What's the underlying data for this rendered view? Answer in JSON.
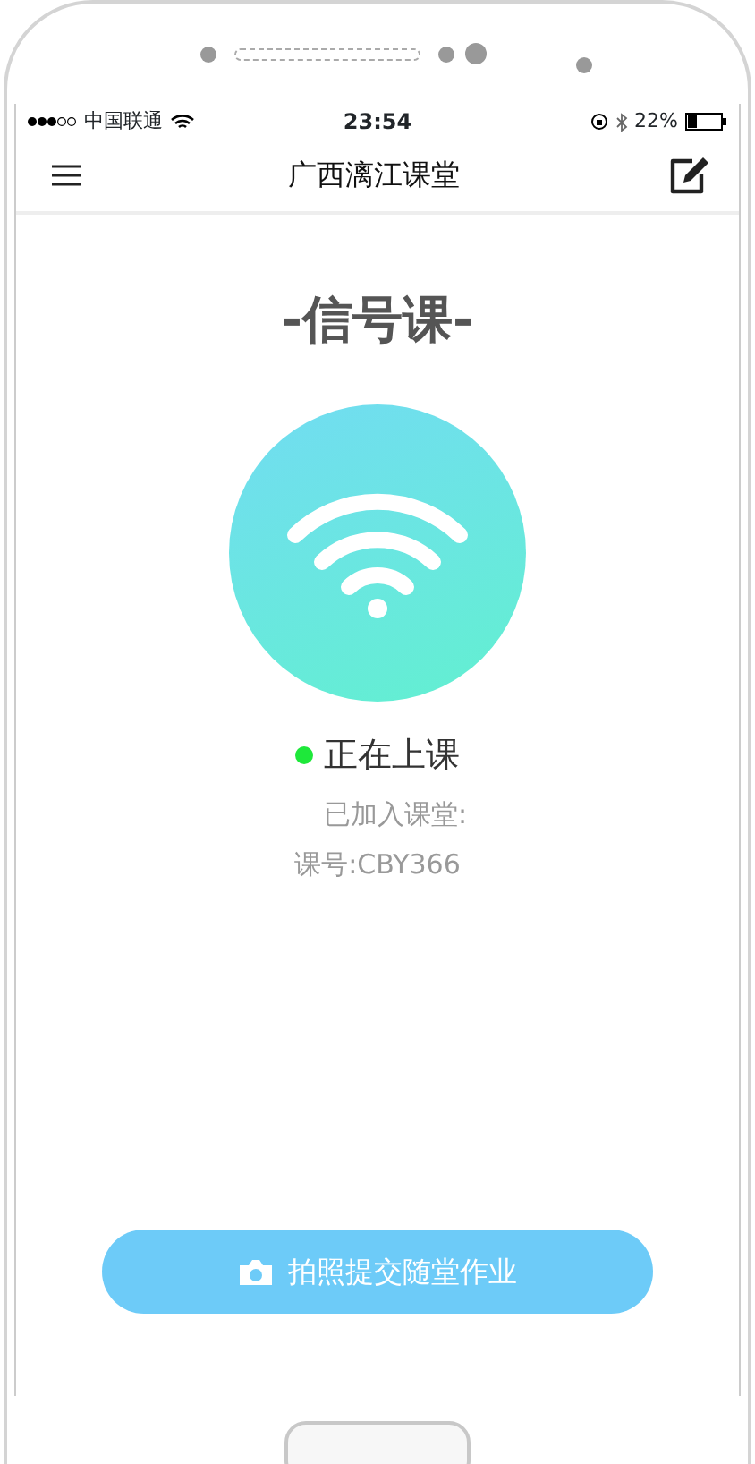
{
  "status_bar": {
    "carrier": "中国联通",
    "time": "23:54",
    "battery": "22%"
  },
  "nav": {
    "title": "广西漓江课堂"
  },
  "heading": "-信号课-",
  "status": {
    "text": "正在上课",
    "active": true
  },
  "info": [
    "已加入课堂:",
    "课号:CBY366"
  ],
  "submit_button": {
    "label": "拍照提交随堂作业"
  }
}
